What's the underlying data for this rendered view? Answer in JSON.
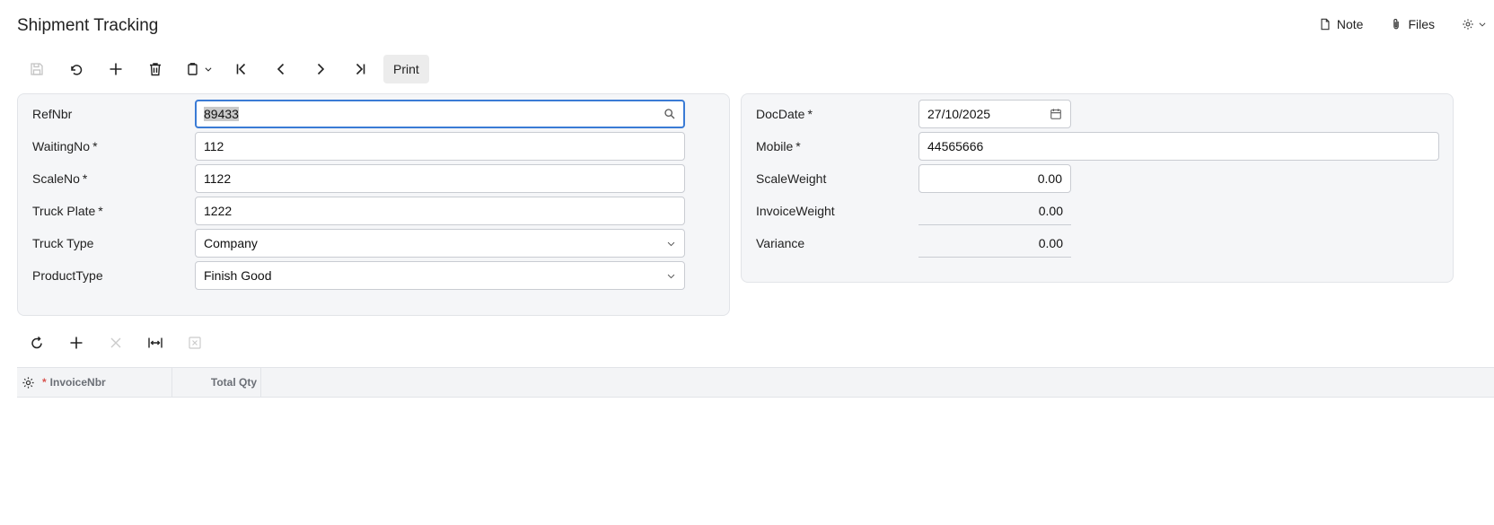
{
  "page": {
    "title": "Shipment Tracking"
  },
  "top_actions": {
    "note_label": "Note",
    "files_label": "Files"
  },
  "toolbar": {
    "print_label": "Print"
  },
  "form_left": {
    "refnbr": {
      "label": "RefNbr",
      "value": "89433"
    },
    "waitingno": {
      "label": "WaitingNo",
      "value": "112"
    },
    "scaleno": {
      "label": "ScaleNo",
      "value": "1122"
    },
    "truck_plate": {
      "label": "Truck Plate",
      "value": "1222"
    },
    "truck_type": {
      "label": "Truck Type",
      "value": "Company"
    },
    "product_type": {
      "label": "ProductType",
      "value": "Finish Good"
    }
  },
  "form_right": {
    "docdate": {
      "label": "DocDate",
      "value": "27/10/2025"
    },
    "mobile": {
      "label": "Mobile",
      "value": "44565666"
    },
    "scale_weight": {
      "label": "ScaleWeight",
      "value": "0.00"
    },
    "invoice_weight": {
      "label": "InvoiceWeight",
      "value": "0.00"
    },
    "variance": {
      "label": "Variance",
      "value": "0.00"
    }
  },
  "required_marker": "*",
  "grid": {
    "columns": [
      "InvoiceNbr",
      "Total Qty"
    ],
    "required_marker": "*"
  }
}
